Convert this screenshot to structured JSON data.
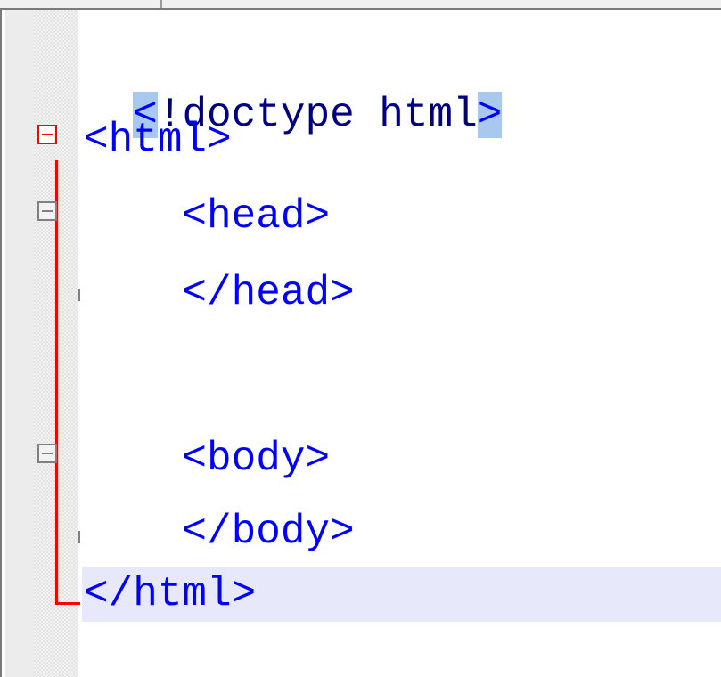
{
  "editor": {
    "lines": [
      {
        "open": "<",
        "bang": "!",
        "rest": "doctype html",
        "close": ">"
      },
      {
        "text": "<html>"
      },
      {
        "text": "    <head>"
      },
      {
        "text": "    </head>"
      },
      {
        "text": ""
      },
      {
        "text": "    <body>"
      },
      {
        "text": "    </body>"
      },
      {
        "text": "</html>"
      }
    ]
  },
  "colors": {
    "tag": "#0000ff",
    "doctype": "#000080",
    "selection": "#a8c8f0",
    "current_line": "#e8e8fb",
    "fold_marker_active": "#ff0000",
    "fold_marker_inactive": "#808080"
  },
  "icons": {
    "fold_toggle": "minus-box-icon"
  }
}
